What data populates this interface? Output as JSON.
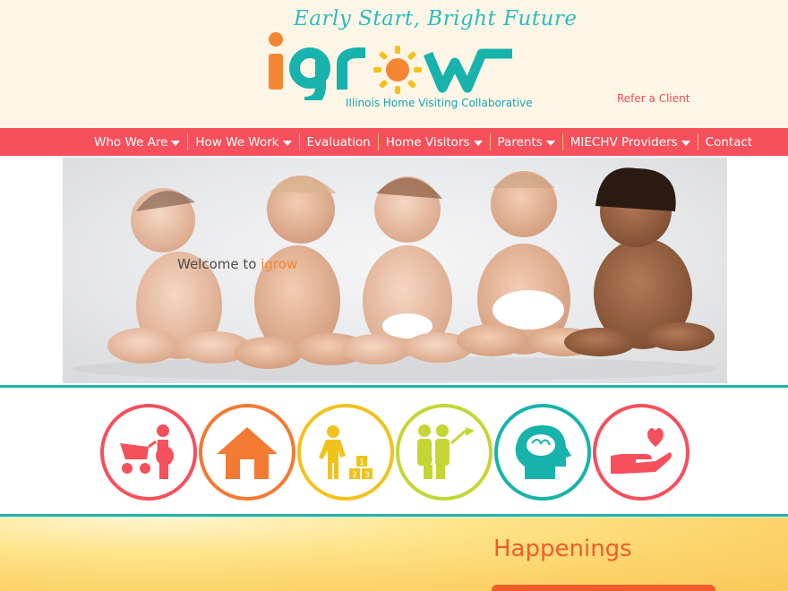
{
  "header": {
    "tagline": "Early Start, Bright Future",
    "logo_text": "igrow",
    "logo_subtitle": "Illinois Home Visiting Collaborative",
    "refer_link": "Refer a Client"
  },
  "nav": {
    "items": [
      {
        "label": "Who We Are",
        "has_dropdown": true
      },
      {
        "label": "How We Work",
        "has_dropdown": true
      },
      {
        "label": "Evaluation",
        "has_dropdown": false
      },
      {
        "label": "Home Visitors",
        "has_dropdown": true
      },
      {
        "label": "Parents",
        "has_dropdown": true
      },
      {
        "label": "MIECHV Providers",
        "has_dropdown": true
      },
      {
        "label": "Contact",
        "has_dropdown": false
      }
    ]
  },
  "hero": {
    "welcome_prefix": "Welcome to ",
    "welcome_brand": "igrow"
  },
  "icon_circles": [
    {
      "icon": "pregnancy-stroller-icon",
      "color": "#f5505c"
    },
    {
      "icon": "house-icon",
      "color": "#f37a32"
    },
    {
      "icon": "child-blocks-icon",
      "color": "#f2c21c"
    },
    {
      "icon": "family-flag-icon",
      "color": "#c5d534"
    },
    {
      "icon": "brain-head-icon",
      "color": "#17b3ac"
    },
    {
      "icon": "heart-hand-icon",
      "color": "#f5505c"
    }
  ],
  "happenings": {
    "title": "Happenings"
  },
  "colors": {
    "coral": "#f5505c",
    "teal": "#20b3ad",
    "orange": "#f37a32",
    "yellow": "#f2c21c",
    "lime": "#c5d534",
    "cream": "#fdf6e6"
  }
}
